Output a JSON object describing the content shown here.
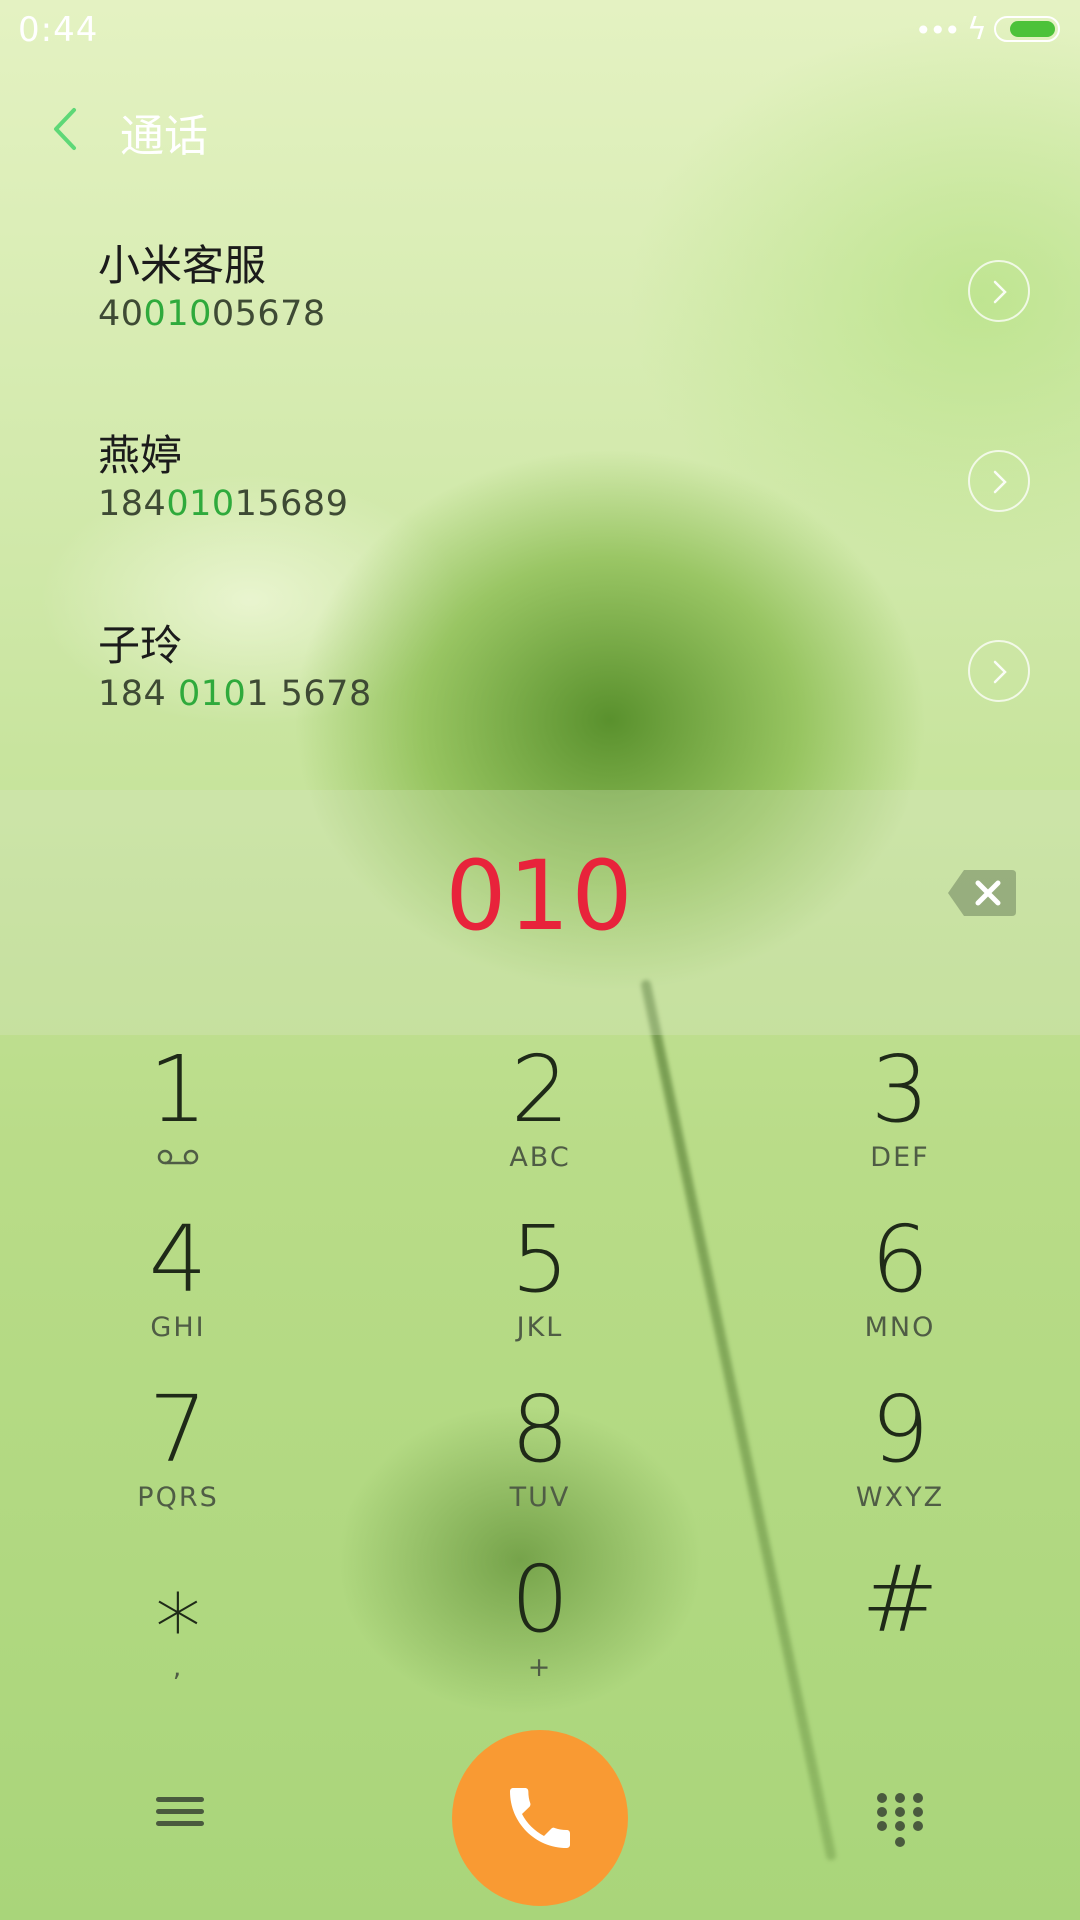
{
  "status_bar": {
    "time": "0:44",
    "signal_dots": "•••",
    "charging_icon": "bolt-icon",
    "battery_level": 0.8
  },
  "header": {
    "title": "通话",
    "back_icon": "chevron-left-icon"
  },
  "suggestions": [
    {
      "name": "小米客服",
      "number_pre": "40",
      "number_match": "010",
      "number_post": "05678"
    },
    {
      "name": "燕婷",
      "number_pre": "184",
      "number_match": "010",
      "number_post": "15689"
    },
    {
      "name": "子玲",
      "number_pre": "184 ",
      "number_match": "010",
      "number_post": "1 5678"
    }
  ],
  "dialed_number": "010",
  "keys": [
    {
      "num": "1",
      "sub": ""
    },
    {
      "num": "2",
      "sub": "ABC"
    },
    {
      "num": "3",
      "sub": "DEF"
    },
    {
      "num": "4",
      "sub": "GHI"
    },
    {
      "num": "5",
      "sub": "JKL"
    },
    {
      "num": "6",
      "sub": "MNO"
    },
    {
      "num": "7",
      "sub": "PQRS"
    },
    {
      "num": "8",
      "sub": "TUV"
    },
    {
      "num": "9",
      "sub": "WXYZ"
    },
    {
      "num": "⁎",
      "sub": ","
    },
    {
      "num": "0",
      "sub": "+"
    },
    {
      "num": "#",
      "sub": ""
    }
  ],
  "colors": {
    "accent_green": "#2faa3c",
    "dialed_red": "#e8233b",
    "call_orange": "#f99a33",
    "battery_green": "#4cc23a"
  }
}
